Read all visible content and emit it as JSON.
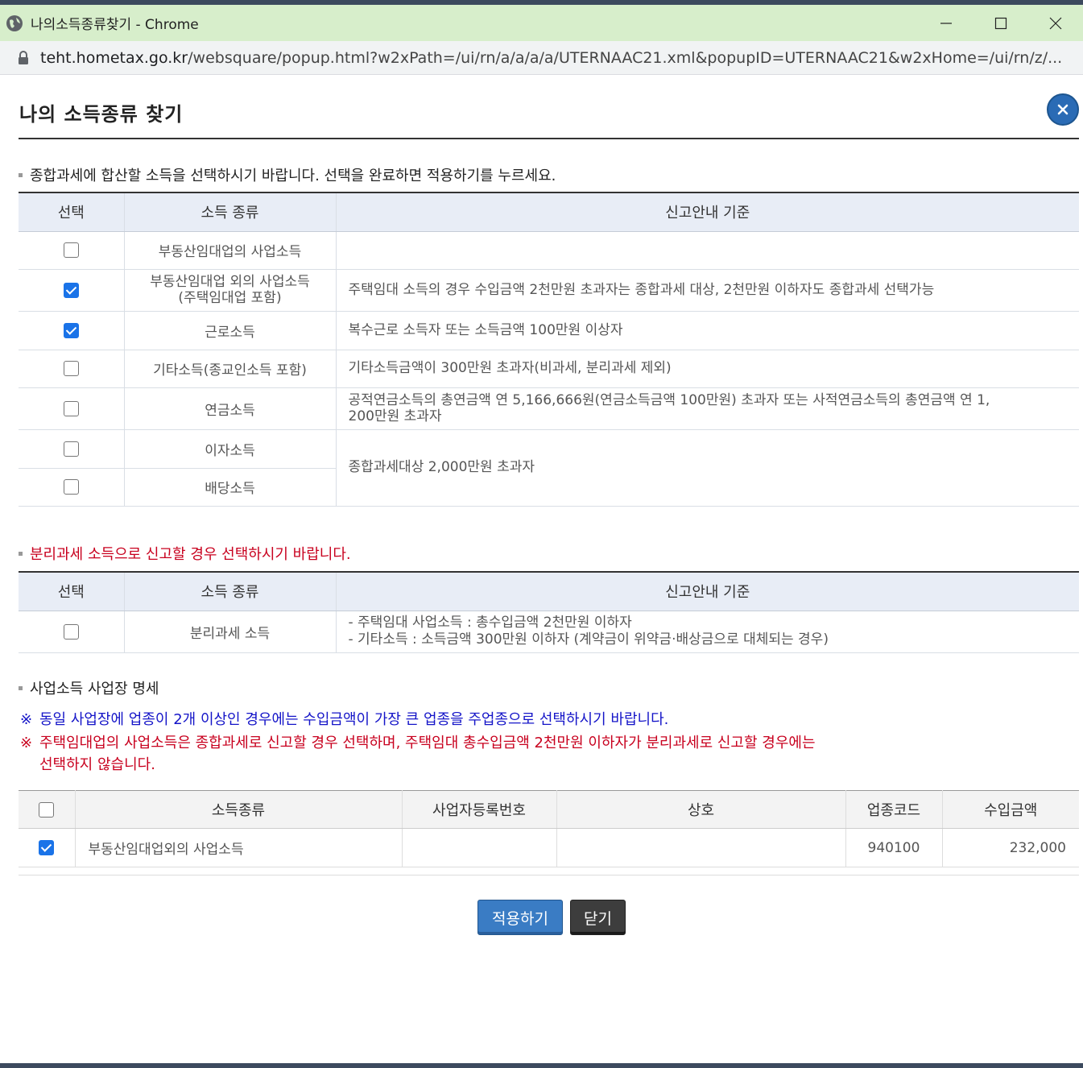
{
  "window": {
    "title": "나의소득종류찾기 - Chrome"
  },
  "address_bar": {
    "host": "teht.hometax.go.kr",
    "path": "/websquare/popup.html?w2xPath=/ui/rn/a/a/a/a/UTERNAAC21.xml&popupID=UTERNAAC21&w2xHome=/ui/rn/z/..."
  },
  "popup": {
    "title": "나의 소득종류 찾기"
  },
  "section1": {
    "heading": "종합과세에 합산할 소득을 선택하시기 바랍니다. 선택을 완료하면 적용하기를 누르세요.",
    "columns": [
      "선택",
      "소득 종류",
      "신고안내 기준"
    ],
    "rows": [
      {
        "checked": false,
        "income_type": "부동산임대업의 사업소득",
        "criteria": ""
      },
      {
        "checked": true,
        "income_type": "부동산임대업 외의 사업소득\n(주택임대업 포함)",
        "criteria": "주택임대 소득의 경우 수입금액 2천만원 초과자는 종합과세 대상, 2천만원 이하자도 종합과세 선택가능"
      },
      {
        "checked": true,
        "income_type": "근로소득",
        "criteria": "복수근로 소득자 또는 소득금액 100만원 이상자"
      },
      {
        "checked": false,
        "income_type": "기타소득(종교인소득 포함)",
        "criteria": "기타소득금액이 300만원 초과자(비과세, 분리과세 제외)"
      },
      {
        "checked": false,
        "income_type": "연금소득",
        "criteria": "공적연금소득의 총연금액 연 5,166,666원(연금소득금액 100만원) 초과자 또는 사적연금소득의 총연금액 연 1,\n200만원 초과자"
      },
      {
        "checked": false,
        "income_type": "이자소득"
      },
      {
        "checked": false,
        "income_type": "배당소득"
      }
    ],
    "shared_criteria": "종합과세대상 2,000만원 초과자"
  },
  "section2": {
    "heading": "분리과세 소득으로 신고할 경우 선택하시기 바랍니다.",
    "columns": [
      "선택",
      "소득 종류",
      "신고안내 기준"
    ],
    "row": {
      "checked": false,
      "income_type": "분리과세 소득",
      "criteria_lines": [
        "- 주택임대 사업소득 : 총수입금액 2천만원 이하자",
        "- 기타소득 : 소득금액 300만원 이하자 (계약금이 위약금·배상금으로 대체되는 경우)"
      ]
    }
  },
  "section3": {
    "heading": "사업소득 사업장 명세",
    "note_mark": "※",
    "note_blue": "동일 사업장에 업종이 2개 이상인 경우에는 수입금액이 가장 큰 업종을 주업종으로 선택하시기 바랍니다.",
    "note_red_1": "주택임대업의 사업소득은 종합과세로 신고할 경우 선택하며, 주택임대 총수입금액 2천만원 이하자가 분리과세로 신고할 경우에는",
    "note_red_2": "선택하지 않습니다.",
    "columns": [
      "소득종류",
      "사업자등록번호",
      "상호",
      "업종코드",
      "수입금액"
    ],
    "header_checked": false,
    "rows": [
      {
        "checked": true,
        "income_type": "부동산임대업외의 사업소득",
        "biz_no": "",
        "name": "",
        "code": "940100",
        "amount": "232,000"
      }
    ]
  },
  "buttons": {
    "apply": "적용하기",
    "close": "닫기"
  }
}
